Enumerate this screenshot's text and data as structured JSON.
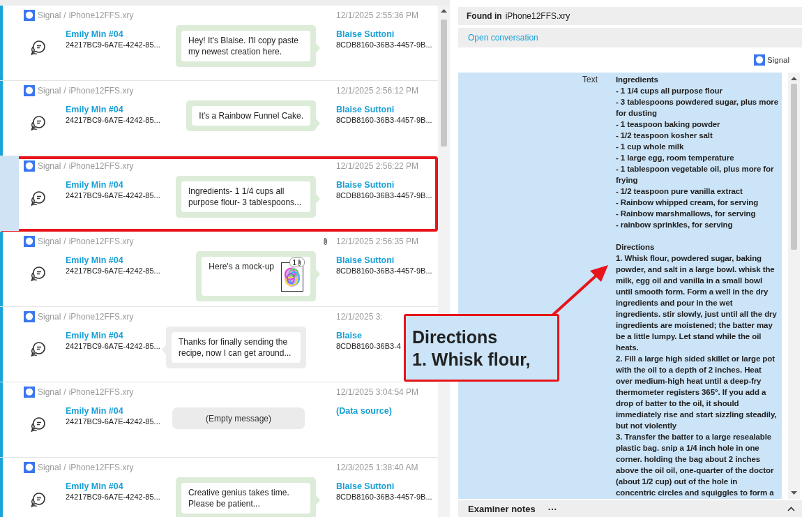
{
  "messages": [
    {
      "source": "Signal",
      "separator": "/",
      "file": "iPhone12FFS.xry",
      "time": "12/1/2025 2:55:36 PM",
      "from": {
        "name": "Emily Min #04",
        "id": "24217BC9-6A7E-4242-85..."
      },
      "to": {
        "name": "Blaise Suttoni",
        "id": "8CDB8160-36B3-4457-9B..."
      },
      "kind": "outgoing",
      "text": "Hey! It's Blaise. I'll copy paste my newest creation here.",
      "selected": false,
      "highlighted": false
    },
    {
      "source": "Signal",
      "separator": "/",
      "file": "iPhone12FFS.xry",
      "time": "12/1/2025 2:56:12 PM",
      "from": {
        "name": "Emily Min #04",
        "id": "24217BC9-6A7E-4242-85..."
      },
      "to": {
        "name": "Blaise Suttoni",
        "id": "8CDB8160-36B3-4457-9B..."
      },
      "kind": "outgoing",
      "text": "It's a Rainbow Funnel Cake.",
      "selected": false,
      "highlighted": false
    },
    {
      "source": "Signal",
      "separator": "/",
      "file": "iPhone12FFS.xry",
      "time": "12/1/2025 2:56:22 PM",
      "from": {
        "name": "Emily Min #04",
        "id": "24217BC9-6A7E-4242-85..."
      },
      "to": {
        "name": "Blaise Suttoni",
        "id": "8CDB8160-36B3-4457-9B..."
      },
      "kind": "outgoing",
      "text": "Ingredients- 1 1/4 cups all purpose flour- 3 tablespoons...",
      "selected": true,
      "highlighted": true
    },
    {
      "source": "Signal",
      "separator": "/",
      "file": "iPhone12FFS.xry",
      "time": "12/1/2025 2:56:35 PM",
      "from": {
        "name": "Emily Min #04",
        "id": "24217BC9-6A7E-4242-85..."
      },
      "to": {
        "name": "Blaise Suttoni",
        "id": "8CDB8160-36B3-4457-9B..."
      },
      "kind": "outgoing",
      "text": "Here's a mock-up",
      "attachment": {
        "count": "1"
      },
      "selected": false,
      "highlighted": false
    },
    {
      "source": "Signal",
      "separator": "/",
      "file": "iPhone12FFS.xry",
      "time": "12/1/2025 3:",
      "from": {
        "name": "Emily Min #04",
        "id": "24217BC9-6A7E-4242-85..."
      },
      "to": {
        "name": "Blaise",
        "id": "8CDB8160-36B3-4"
      },
      "kind": "incoming",
      "text": "Thanks for finally sending the recipe, now I can get around...",
      "selected": false,
      "highlighted": false
    },
    {
      "source": "Signal",
      "separator": "/",
      "file": "iPhone12FFS.xry",
      "time": "12/1/2025 3:04:54 PM",
      "from": {
        "name": "Emily Min #04",
        "id": "24217BC9-6A7E-4242-85..."
      },
      "to": {
        "name": "(Data source)"
      },
      "kind": "empty",
      "text": "(Empty message)",
      "selected": false,
      "highlighted": false
    },
    {
      "source": "Signal",
      "separator": "/",
      "file": "iPhone12FFS.xry",
      "time": "12/3/2025 1:38:40 AM",
      "from": {
        "name": "Emily Min #04",
        "id": "24217BC9-6A7E-4242-85..."
      },
      "to": {
        "name": "Blaise Suttoni",
        "id": "8CDB8160-36B3-4457-9B..."
      },
      "kind": "outgoing",
      "text": "Creative genius takes time. Please be patient...",
      "selected": false,
      "highlighted": false
    }
  ],
  "details": {
    "found_in_label": "Found in",
    "found_in": "iPhone12FFS.xry",
    "open_conversation": "Open conversation",
    "source": "Signal",
    "field_label": "Text",
    "field_value": "Ingredients\n- 1 1/4 cups all purpose flour\n- 3 tablespoons powdered sugar, plus more for dusting\n- 1 teaspoon baking powder\n- 1/2 teaspoon kosher salt\n- 1 cup whole milk\n- 1 large egg, room temperature\n- 1 tablespoon vegetable oil, plus more for frying\n- 1/2 teaspoon pure vanilla extract\n- Rainbow whipped cream, for serving\n- Rainbow marshmallows, for serving\n- rainbow sprinkles, for serving\n\nDirections\n1. Whisk flour, powdered sugar, baking powder, and salt in a large bowl. whisk the milk, egg oil and vanilla in a small bowl until smooth form. Form a well in the dry ingredients and pour in the wet ingredients. stir slowly, just until all the dry ingredients are moistened; the batter may be a little lumpy. Let stand while the oil heats.\n2. Fill a large high sided skillet or large pot with the oil to a depth of 2 inches. Heat over medium-high heat until a deep-fry thermometer registers 365°. If you add a drop of batter to the oil, it should immediately rise and start sizzling steadily, but not violently\n3. Transfer the batter to a large resealable plastic bag. snip a 1/4 inch hole in one corner. holding the bag about 2 inches above the oil oil, one-quarter of the doctor (about 1/2 cup) out of the hole in concentric circles and squiggles to form a"
  },
  "examiner_notes": {
    "title": "Examiner notes",
    "menu": "···"
  },
  "callout": {
    "lines": [
      "Directions",
      "1. Whisk flour,"
    ]
  }
}
